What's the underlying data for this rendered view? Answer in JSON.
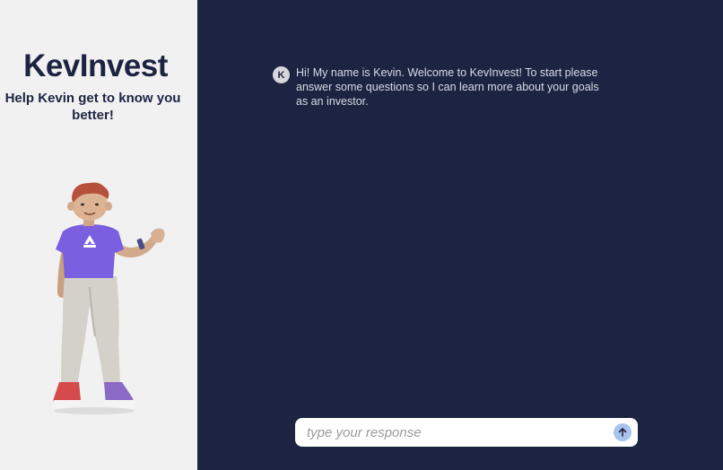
{
  "sidebar": {
    "brand": "KevInvest",
    "tagline": "Help Kevin get to know you better!"
  },
  "chat": {
    "messages": [
      {
        "avatar_letter": "K",
        "text": "Hi! My name is Kevin. Welcome to KevInvest! To start please answer some questions so I can learn more about your goals as an investor."
      }
    ]
  },
  "composer": {
    "placeholder": "type your response",
    "value": "",
    "send_icon": "arrow-up-icon"
  },
  "colors": {
    "sidebar_bg": "#f1f1f1",
    "main_bg": "#1d2442",
    "brand_text": "#1d2442",
    "send_button": "#a9c4ec",
    "shirt": "#7a5fe0"
  }
}
